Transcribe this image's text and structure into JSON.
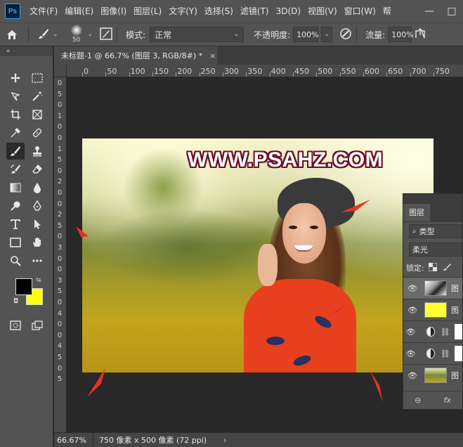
{
  "app": {
    "logo": "Ps"
  },
  "menu": [
    "文件(F)",
    "编辑(E)",
    "图像(I)",
    "图层(L)",
    "文字(Y)",
    "选择(S)",
    "滤镜(T)",
    "3D(D)",
    "视图(V)",
    "窗口(W)",
    "帮"
  ],
  "window_controls": {
    "minimize": "—",
    "maximize": "□"
  },
  "options": {
    "brush_size": "50",
    "mode_label": "模式:",
    "mode_value": "正常",
    "opacity_label": "不透明度:",
    "opacity_value": "100%",
    "flow_label": "流量:",
    "flow_value": "100%"
  },
  "toolbar": {
    "collapse": "«"
  },
  "document_tab": {
    "title": "未标题-1 @ 66.7% (图层 3, RGB/8#) *",
    "close": "×"
  },
  "ruler_h": [
    "0",
    "50",
    "100",
    "150",
    "200",
    "250",
    "300",
    "350",
    "400",
    "450",
    "500",
    "550",
    "600",
    "650",
    "700",
    "750"
  ],
  "ruler_v": [
    "0",
    "5",
    "0",
    "1",
    "0",
    "0",
    "1",
    "5",
    "0",
    "2",
    "0",
    "0",
    "2",
    "5",
    "0",
    "3",
    "0",
    "0",
    "3",
    "5",
    "0",
    "4",
    "0",
    "0",
    "4",
    "5",
    "0",
    "5"
  ],
  "canvas": {
    "watermark": "WWW.PSAHZ.COM"
  },
  "layers_panel": {
    "tab": "图层",
    "filter": "类型",
    "blend_mode": "柔光",
    "lock_label": "锁定:",
    "layers": [
      {
        "name": "图",
        "thumb_color": "#d8d8d8",
        "selected": true
      },
      {
        "name": "图",
        "thumb_color": "#ffff33",
        "selected": false
      },
      {
        "name": "",
        "adjustment": true
      },
      {
        "name": "",
        "adjustment": true
      },
      {
        "name": "图",
        "thumb_color": "#8a8a3a",
        "selected": false
      }
    ],
    "footer_link": "⊖",
    "footer_fx": "fx"
  },
  "status": {
    "zoom": "66.67%",
    "doc_info": "750 像素 x 500 像素 (72 ppi)",
    "arrow": "›"
  },
  "colors": {
    "foreground": "#000000",
    "background": "#ffff00",
    "arrow_red": "#e8302a"
  }
}
